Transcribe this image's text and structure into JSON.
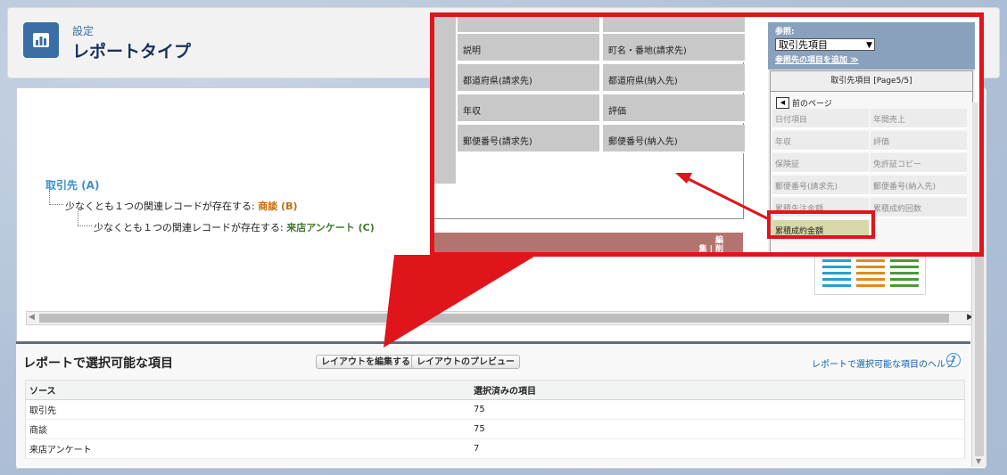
{
  "header": {
    "supertitle": "設定",
    "title": "レポートタイプ"
  },
  "tree": {
    "root_label": "取引先 (A)",
    "level1_prefix": "少なくとも１つの関連レコードが存在する:",
    "level1_value": "商談 (B)",
    "level2_prefix": "少なくとも１つの関連レコードが存在する:",
    "level2_value": "来店アンケート (C)"
  },
  "layout_grid": {
    "rows": [
      [
        "説明",
        "町名・番地(請求先)"
      ],
      [
        "都道府県(請求先)",
        "都道府県(納入先)"
      ],
      [
        "年収",
        "評価"
      ],
      [
        "郵便番号(請求先)",
        "郵便番号(納入先)"
      ]
    ],
    "footer_text_1": "編",
    "footer_text_2": "集 | 削"
  },
  "field_panel": {
    "ref_label": "参照:",
    "ref_select_value": "取引先項目",
    "ref_add_link": "参照先の項目を追加 ≫",
    "panel_title": "取引先項目 [Page5/5]",
    "prev_label": "前のページ",
    "fields": [
      [
        "日付項目",
        "年間売上"
      ],
      [
        "年収",
        "評価"
      ],
      [
        "保険証",
        "免許証コピー"
      ],
      [
        "郵便番号(請求先)",
        "郵便番号(納入先)"
      ],
      [
        "累積先注金額",
        "累積成約回数"
      ]
    ],
    "highlighted_field": "累積成約金額"
  },
  "section": {
    "title": "レポートで選択可能な項目",
    "edit_layout_button": "レイアウトを編集する",
    "preview_layout_button": "レイアウトのプレビュー",
    "help_link": "レポートで選択可能な項目のヘルプ",
    "help_icon": "?",
    "table": {
      "headers": [
        "ソース",
        "選択済みの項目"
      ],
      "rows": [
        [
          "取引先",
          "75"
        ],
        [
          "商談",
          "75"
        ],
        [
          "来店アンケート",
          "7"
        ]
      ]
    }
  },
  "colors": {
    "accent_red": "#e0141b",
    "header_icon": "#3a6ea5",
    "object_b": "#c66a0e",
    "object_c": "#3d7a2d"
  }
}
